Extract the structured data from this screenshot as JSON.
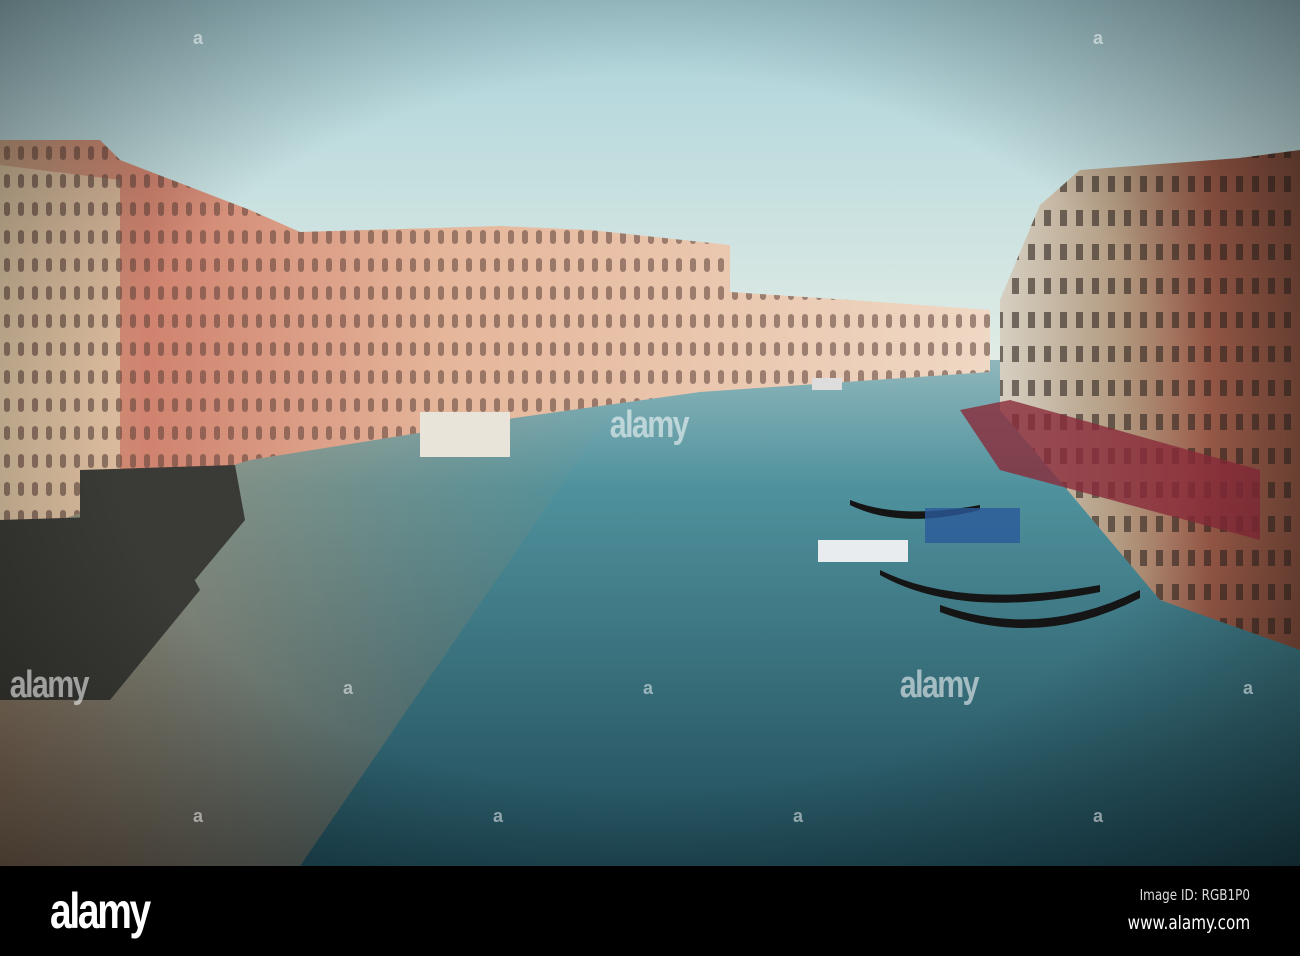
{
  "image": {
    "subject": "Grand Canal, Venice",
    "colors": {
      "sky_top": "#a9d2da",
      "sky_horizon": "#f3f1e6",
      "water": "#3f8492",
      "water_dark": "#1f4753",
      "bar": "#000000"
    }
  },
  "footer": {
    "logo": "alamy",
    "image_id": "Image ID: RGB1P0",
    "url": "www.alamy.com"
  },
  "watermark": {
    "text": "alamy",
    "center_text": "alamy",
    "mark": "a"
  }
}
